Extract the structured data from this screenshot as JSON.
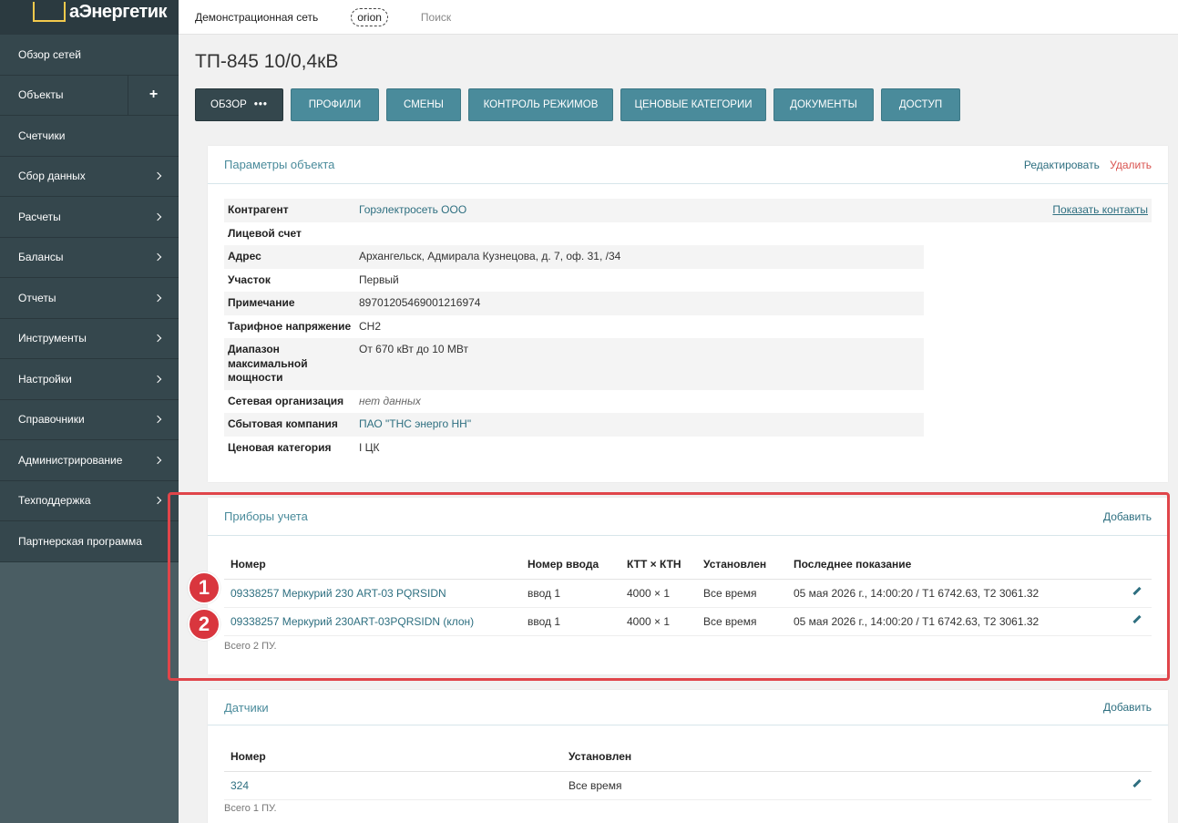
{
  "logo": {
    "text": "аЭнергетик"
  },
  "topbar": {
    "network": "Демонстрационная сеть",
    "user": "orion",
    "search": "Поиск"
  },
  "sidebar": {
    "items": [
      {
        "label": "Обзор сетей"
      },
      {
        "label": "Объекты",
        "action": "+"
      },
      {
        "label": "Счетчики"
      },
      {
        "label": "Сбор данных"
      },
      {
        "label": "Расчеты"
      },
      {
        "label": "Балансы"
      },
      {
        "label": "Отчеты"
      },
      {
        "label": "Инструменты"
      },
      {
        "label": "Настройки"
      },
      {
        "label": "Справочники"
      },
      {
        "label": "Администрирование"
      },
      {
        "label": "Техподдержка"
      },
      {
        "label": "Партнерская программа"
      }
    ]
  },
  "page": {
    "title": "ТП-845 10/0,4кВ"
  },
  "tabs": [
    {
      "label": "ОБЗОР",
      "dots": "•••"
    },
    {
      "label": "ПРОФИЛИ"
    },
    {
      "label": "СМЕНЫ"
    },
    {
      "label": "КОНТРОЛЬ РЕЖИМОВ"
    },
    {
      "label": "ЦЕНОВЫЕ КАТЕГОРИИ"
    },
    {
      "label": "ДОКУМЕНТЫ"
    },
    {
      "label": "ДОСТУП"
    }
  ],
  "params_panel": {
    "title": "Параметры объекта",
    "edit": "Редактировать",
    "delete": "Удалить",
    "show_contacts": "Показать контакты",
    "rows": [
      {
        "key": "Контрагент",
        "value": "Горэлектросеть ООО"
      },
      {
        "key": "Лицевой счет",
        "value": ""
      },
      {
        "key": "Адрес",
        "value": "Архангельск, Адмирала Кузнецова, д. 7, оф. 31, /34"
      },
      {
        "key": "Участок",
        "value": "Первый"
      },
      {
        "key": "Примечание",
        "value": "89701205469001216974"
      },
      {
        "key": "Тарифное напряжение",
        "value": "СН2"
      },
      {
        "key": "Диапазон максимальной мощности",
        "value": "От 670 кВт до 10 МВт"
      },
      {
        "key": "Сетевая организация",
        "value": "нет данных"
      },
      {
        "key": "Сбытовая компания",
        "value": "ПАО \"ТНС энерго НН\""
      },
      {
        "key": "Ценовая категория",
        "value": "I ЦК"
      }
    ]
  },
  "meters_panel": {
    "title": "Приборы учета",
    "add": "Добавить",
    "columns": [
      "Номер",
      "Номер ввода",
      "КТТ × КТН",
      "Установлен",
      "Последнее показание"
    ],
    "rows": [
      {
        "number": "09338257 Меркурий 230 ART-03 PQRSIDN",
        "input": "ввод 1",
        "ratio": "4000 × 1",
        "installed": "Все время",
        "last": "05 мая 2026 г., 14:00:20 / Т1 6742.63, Т2 3061.32"
      },
      {
        "number": "09338257 Меркурий 230ART-03PQRSIDN (клон)",
        "input": "ввод 1",
        "ratio": "4000 × 1",
        "installed": "Все время",
        "last": "05 мая 2026 г., 14:00:20 / Т1 6742.63, Т2 3061.32"
      }
    ],
    "total": "Всего 2 ПУ.",
    "badges": [
      "1",
      "2"
    ]
  },
  "sensors_panel": {
    "title": "Датчики",
    "add": "Добавить",
    "columns": [
      "Номер",
      "Установлен"
    ],
    "rows": [
      {
        "number": "324",
        "installed": "Все время"
      }
    ],
    "total": "Всего 1 ПУ."
  }
}
